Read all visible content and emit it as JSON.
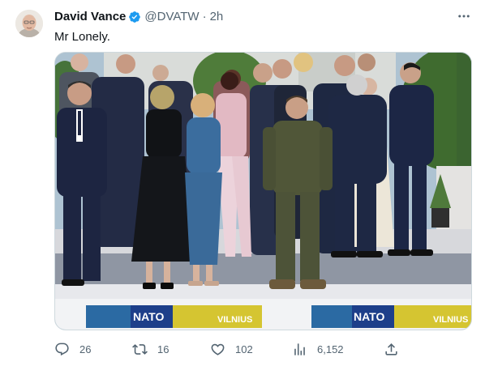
{
  "author": {
    "name": "David Vance",
    "handle": "@DVATW",
    "separator": "·",
    "time": "2h"
  },
  "tweet": {
    "text": "Mr Lonely."
  },
  "media": {
    "banner_left_text": "NATO",
    "banner_right_text": "VILNIUS"
  },
  "actions": {
    "replies": "26",
    "retweets": "16",
    "likes": "102",
    "views": "6,152"
  },
  "icons": {
    "verified": "verified-badge-icon",
    "more": "more-options-icon",
    "reply": "reply-icon",
    "retweet": "retweet-icon",
    "like": "like-icon",
    "views": "views-icon",
    "share": "share-icon"
  },
  "colors": {
    "verified_blue": "#1d9bf0",
    "text_primary": "#0f1419",
    "text_secondary": "#536471",
    "nato_blue": "#1d3f8a",
    "vilnius_yellow": "#d5c531"
  }
}
